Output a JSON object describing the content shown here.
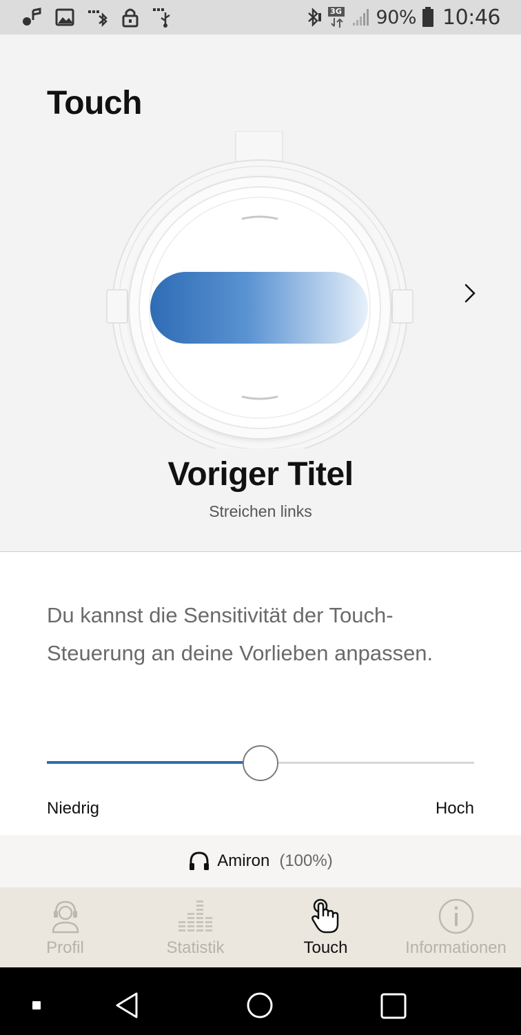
{
  "status_bar": {
    "battery_percent": "90%",
    "time": "10:46",
    "network_type": "3G",
    "left_icons": [
      "bluetooth-music-icon",
      "image-icon",
      "bluetooth-dots-icon",
      "lock-icon",
      "usb-icon"
    ],
    "right_icons": [
      "bluetooth-icon",
      "network-3g-icon",
      "signal-icon",
      "battery-icon"
    ]
  },
  "header": {
    "title": "Touch"
  },
  "gesture": {
    "title": "Voriger Titel",
    "subtitle": "Streichen links"
  },
  "sensitivity": {
    "description": "Du kannst die Sensitivität der Touch-Steuerung an deine Vorlieben anpassen.",
    "low_label": "Niedrig",
    "high_label": "Hoch",
    "level": 0.5
  },
  "device": {
    "name": "Amiron",
    "battery": "(100%)"
  },
  "bottom_nav": {
    "items": [
      {
        "label": "Profil",
        "icon": "profile-icon",
        "active": false
      },
      {
        "label": "Statistik",
        "icon": "statistics-icon",
        "active": false
      },
      {
        "label": "Touch",
        "icon": "touch-icon",
        "active": true
      },
      {
        "label": "Informationen",
        "icon": "info-icon",
        "active": false
      }
    ]
  },
  "colors": {
    "accent": "#2e6cb5",
    "nav_background": "#ebe7de",
    "nav_inactive": "#b7b2a8"
  }
}
